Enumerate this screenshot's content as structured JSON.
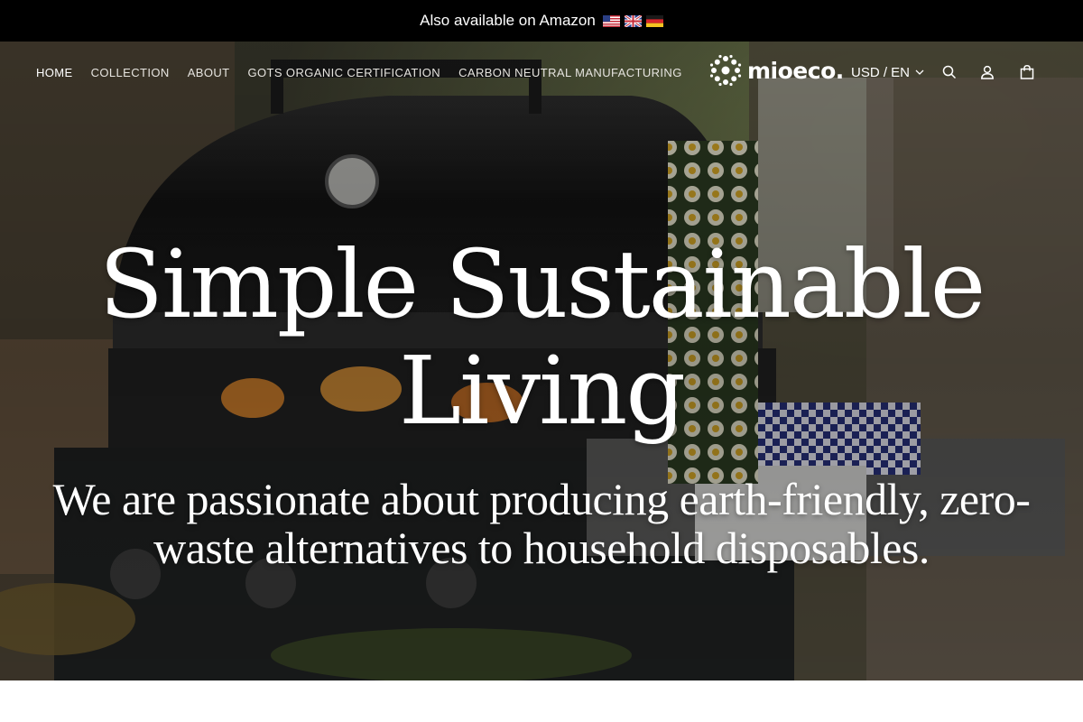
{
  "announcement": {
    "text": "Also available on Amazon",
    "flags": [
      "us-flag",
      "uk-flag",
      "de-flag"
    ]
  },
  "nav": {
    "items": [
      {
        "label": "HOME",
        "active": true
      },
      {
        "label": "COLLECTION",
        "active": false
      },
      {
        "label": "ABOUT",
        "active": false
      },
      {
        "label": "GOTS ORGANIC CERTIFICATION",
        "active": false
      },
      {
        "label": "CARBON NEUTRAL MANUFACTURING",
        "active": false
      }
    ]
  },
  "brand": {
    "name": "mioeco.",
    "logo_icon": "flower-logo-icon"
  },
  "locale": {
    "label": "USD / EN",
    "icon": "chevron-down-icon"
  },
  "header_icons": [
    "search-icon",
    "account-icon",
    "cart-icon"
  ],
  "hero": {
    "headline": "Simple Sustainable Living",
    "subheadline": "We are passionate about producing earth-friendly, zero-waste alternatives to household disposables.",
    "background": "grill-and-food-wraps-photo"
  },
  "colors": {
    "announcement_bg": "#000000",
    "text_light": "#ffffff"
  }
}
